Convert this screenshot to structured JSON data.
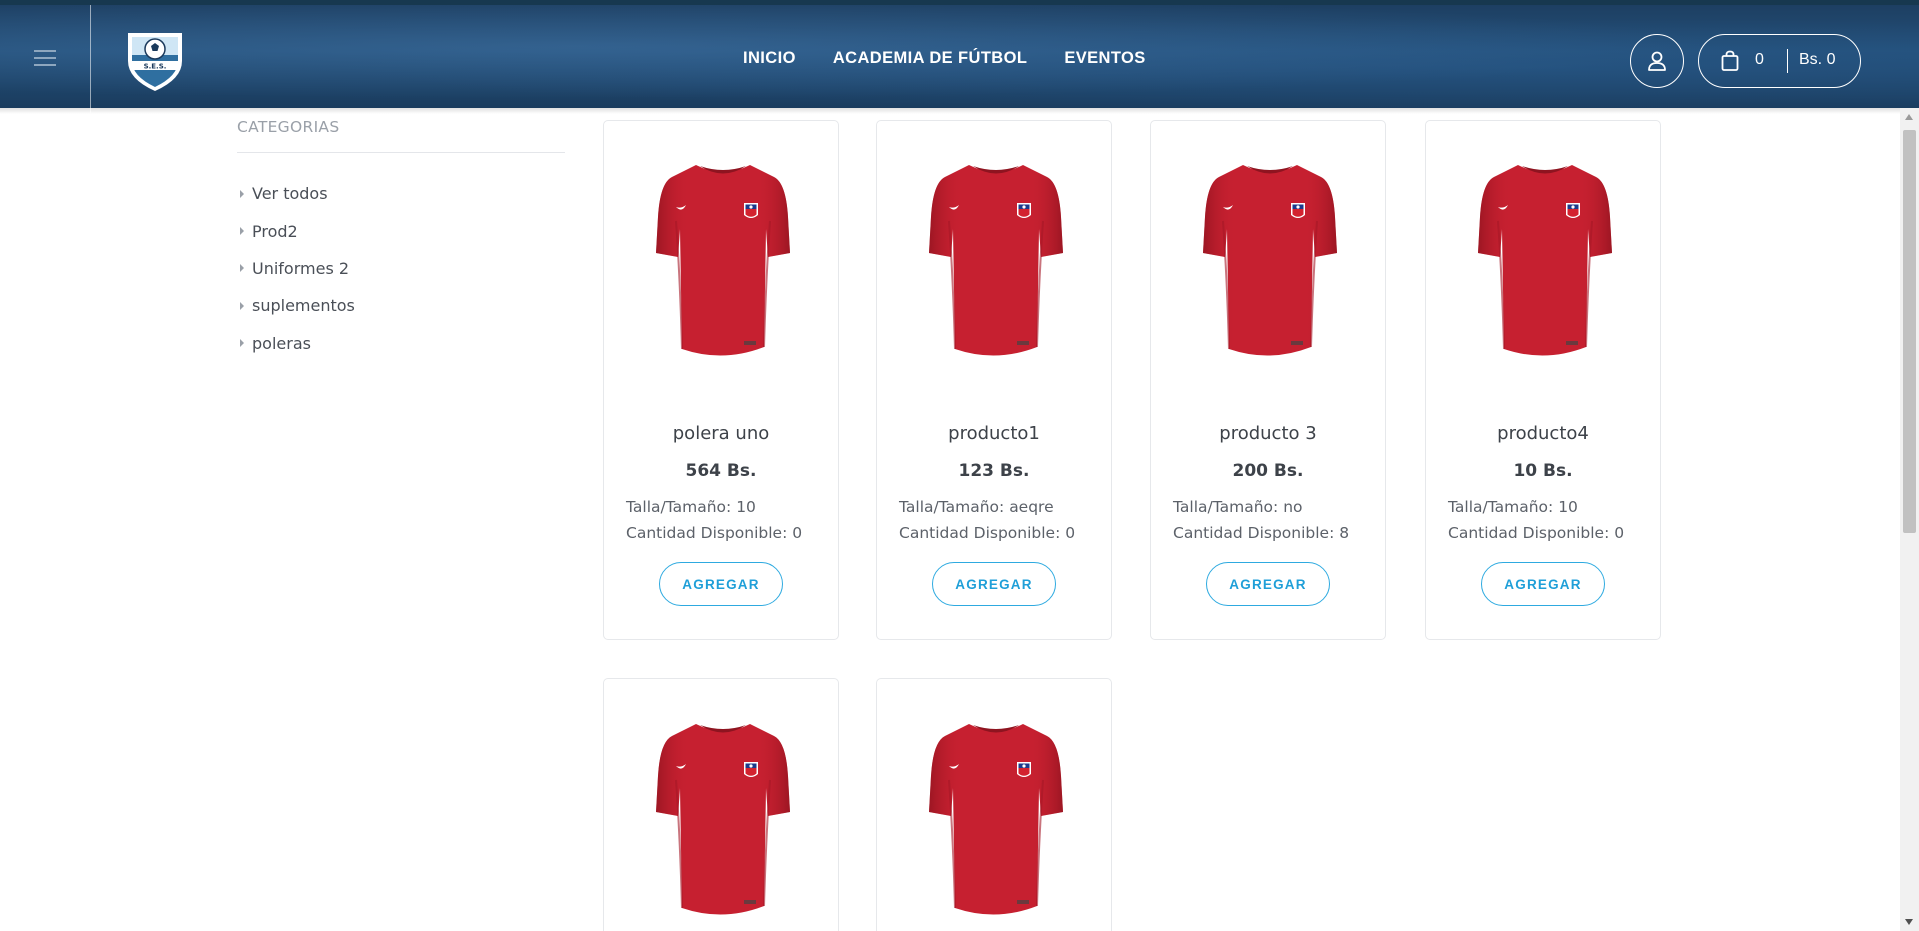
{
  "header": {
    "nav": [
      {
        "label": "INICIO"
      },
      {
        "label": "ACADEMIA DE FÚTBOL"
      },
      {
        "label": "EVENTOS"
      }
    ],
    "cart": {
      "count": "0",
      "total": "Bs. 0"
    },
    "logo_text": "S.E.S."
  },
  "sidebar": {
    "title": "CATEGORIAS",
    "items": [
      {
        "label": "Ver todos"
      },
      {
        "label": "Prod2"
      },
      {
        "label": "Uniformes 2"
      },
      {
        "label": "suplementos"
      },
      {
        "label": "poleras"
      }
    ]
  },
  "products": [
    {
      "name": "polera uno",
      "price": "564 Bs.",
      "size": "Talla/Tamaño: 10",
      "qty": "Cantidad Disponible: 0",
      "button": "AGREGAR"
    },
    {
      "name": "producto1",
      "price": "123 Bs.",
      "size": "Talla/Tamaño: aeqre",
      "qty": "Cantidad Disponible: 0",
      "button": "AGREGAR"
    },
    {
      "name": "producto 3",
      "price": "200 Bs.",
      "size": "Talla/Tamaño: no",
      "qty": "Cantidad Disponible: 8",
      "button": "AGREGAR"
    },
    {
      "name": "producto4",
      "price": "10 Bs.",
      "size": "Talla/Tamaño: 10",
      "qty": "Cantidad Disponible: 0",
      "button": "AGREGAR"
    }
  ],
  "colors": {
    "header": "#1f4770",
    "accent": "#2eaae0",
    "shirt": "#c8202e"
  }
}
